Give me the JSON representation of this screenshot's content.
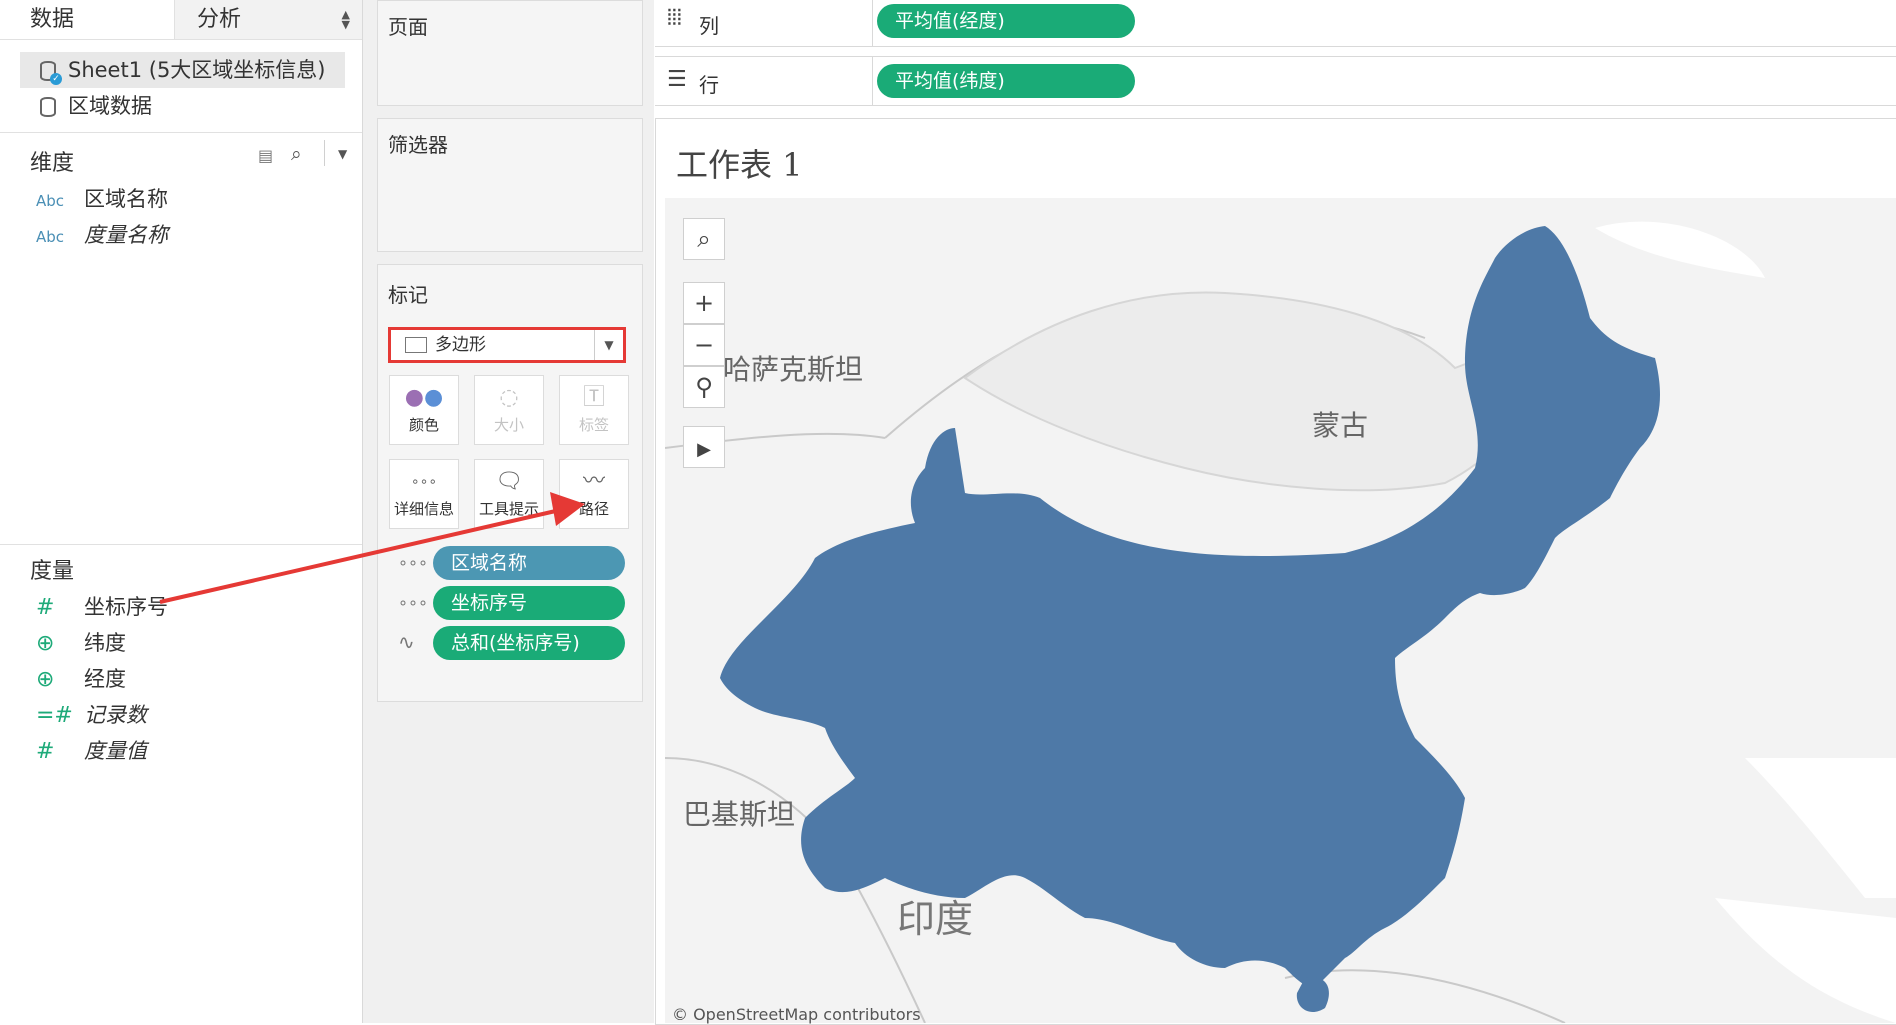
{
  "left_pane": {
    "tabs": [
      "数据",
      "分析"
    ],
    "datasources": [
      {
        "label": "Sheet1 (5大区域坐标信息)",
        "selected": true
      },
      {
        "label": "区域数据",
        "selected": false
      }
    ],
    "dimensions_title": "维度",
    "dimensions": [
      {
        "type": "Abc",
        "label": "区域名称",
        "italic": false
      },
      {
        "type": "Abc",
        "label": "度量名称",
        "italic": true
      }
    ],
    "measures_title": "度量",
    "measures": [
      {
        "type": "#",
        "label": "坐标序号",
        "italic": false
      },
      {
        "type": "globe",
        "label": "纬度",
        "italic": false
      },
      {
        "type": "globe",
        "label": "经度",
        "italic": false
      },
      {
        "type": "=#",
        "label": "记录数",
        "italic": true
      },
      {
        "type": "#",
        "label": "度量值",
        "italic": true
      }
    ]
  },
  "cards": {
    "pages": "页面",
    "filters": "筛选器",
    "marks": "标记",
    "mark_type": "多边形",
    "mark_buttons": [
      {
        "label": "颜色",
        "icon": "color-dots-icon"
      },
      {
        "label": "大小",
        "icon": "size-icon"
      },
      {
        "label": "标签",
        "icon": "label-icon"
      },
      {
        "label": "详细信息",
        "icon": "detail-icon"
      },
      {
        "label": "工具提示",
        "icon": "tooltip-icon"
      },
      {
        "label": "路径",
        "icon": "path-icon"
      }
    ],
    "mark_pills": [
      {
        "icon": "detail-icon",
        "label": "区域名称",
        "color": "#4c97b3"
      },
      {
        "icon": "detail-icon",
        "label": "坐标序号",
        "color": "#1aab77"
      },
      {
        "icon": "path-icon",
        "label": "总和(坐标序号)",
        "color": "#1aab77"
      }
    ]
  },
  "shelves": {
    "columns_label": "列",
    "columns_pill": "平均值(经度)",
    "rows_label": "行",
    "rows_pill": "平均值(纬度)"
  },
  "sheet": {
    "title": "工作表 1",
    "map_labels": [
      "哈萨克斯坦",
      "蒙古",
      "巴基斯坦",
      "印度"
    ],
    "credit": "© OpenStreetMap contributors",
    "fill_color": "#4e79a7"
  }
}
